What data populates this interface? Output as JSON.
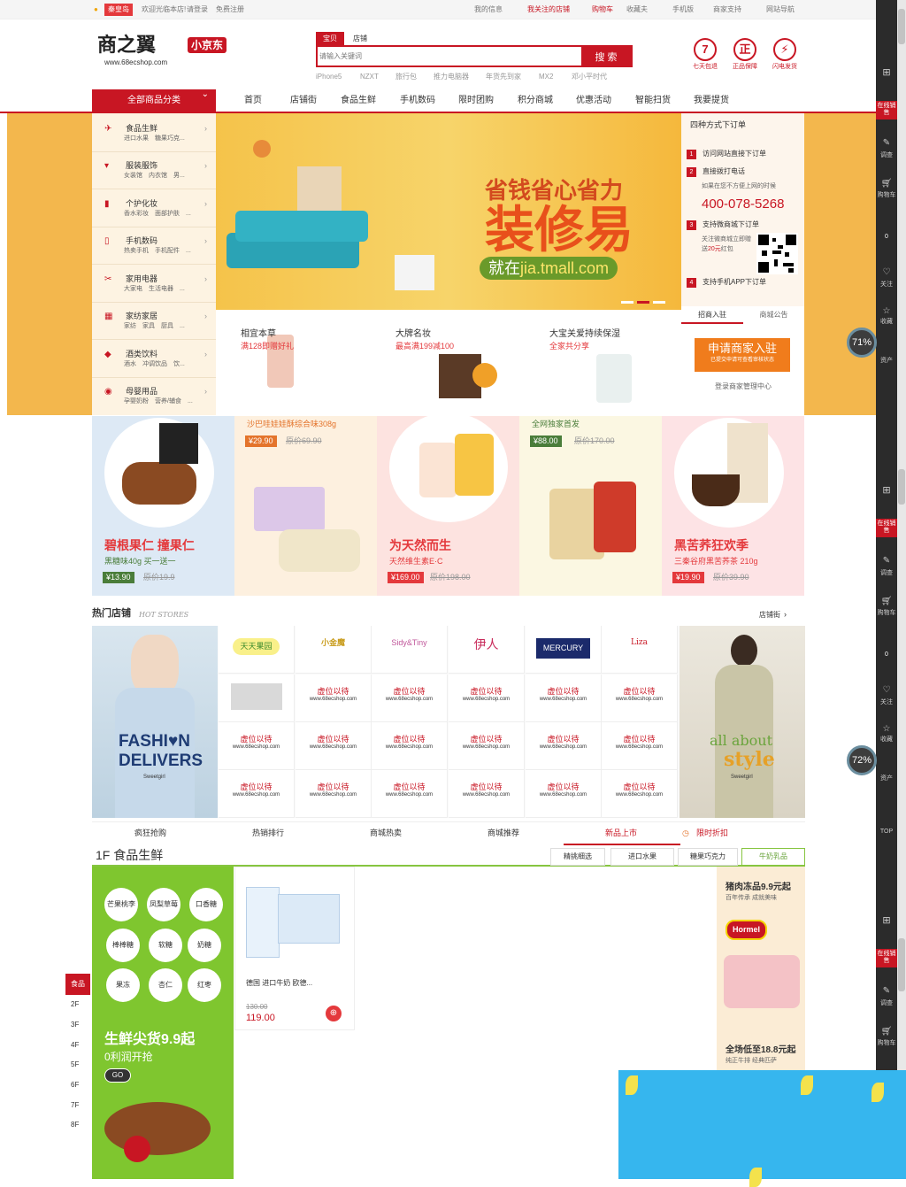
{
  "topbar": {
    "city": "秦皇岛",
    "welcome": "欢迎光临本店!",
    "login": "请登录",
    "register": "免费注册",
    "links": [
      "我的信息",
      "我关注的店铺",
      "购物车",
      "收藏夫",
      "手机版",
      "商家支持",
      "网站导航"
    ]
  },
  "header": {
    "logo_text": "商之翼",
    "logo_tag": "小京东",
    "logo_url": "www.68ecshop.com",
    "search_tabs": [
      "宝贝",
      "店铺"
    ],
    "search_placeholder": "请输入关键词",
    "search_button": "搜 索",
    "hot_words": [
      "iPhone5",
      "NZXT",
      "旅行包",
      "推力电脑器",
      "年货先到家",
      "MX2",
      "邓小平时代"
    ],
    "services": [
      {
        "icon": "7",
        "label": "七天包退"
      },
      {
        "icon": "正",
        "label": "正品保障"
      },
      {
        "icon": "⚡",
        "label": "闪电发货"
      }
    ]
  },
  "nav": {
    "all_categories": "全部商品分类",
    "items": [
      "首页",
      "店铺街",
      "食品生鲜",
      "手机数码",
      "限时团购",
      "积分商城",
      "优惠活动",
      "智能扫货",
      "我要提货"
    ]
  },
  "categories": [
    {
      "name": "食品生鲜",
      "sub": "进口水果　糖果巧克..."
    },
    {
      "name": "服装服饰",
      "sub": "女装馆　内衣馆　男..."
    },
    {
      "name": "个护化妆",
      "sub": "香水彩妆　面部护肤　..."
    },
    {
      "name": "手机数码",
      "sub": "热卖手机　手机配件　..."
    },
    {
      "name": "家用电器",
      "sub": "大家电　生活电器　..."
    },
    {
      "name": "家纺家居",
      "sub": "家纺　家具　厨具　..."
    },
    {
      "name": "酒类饮料",
      "sub": "酒水　冲调饮品　饮..."
    },
    {
      "name": "母婴用品",
      "sub": "孕婴奶粉　营养/辅食　..."
    }
  ],
  "hero": {
    "line1": "省钱省心省力",
    "line2": "装修易",
    "line3_prefix": "就在",
    "line3_url": "jia.tmall.com"
  },
  "order_box": {
    "title": "四种方式下订单",
    "steps": [
      {
        "n": "1",
        "text": "访问网站直接下订单"
      },
      {
        "n": "2",
        "text": "直接拨打电话"
      },
      {
        "n": "3",
        "text": "支持微商城下订单"
      },
      {
        "n": "4",
        "text": "支持手机APP下订单"
      }
    ],
    "phone_note": "如果在您不方便上网的时候",
    "phone": "400-078-5268",
    "wechat_note": "关注微商城立即赠送",
    "wechat_amount": "20元",
    "wechat_tail": "红包"
  },
  "promos": [
    {
      "title": "相宜本草",
      "sub": "满128即赠好礼"
    },
    {
      "title": "大牌名妆",
      "sub": "最高满199减100"
    },
    {
      "title": "大宝关爱持续保湿",
      "sub": "全家共分享"
    }
  ],
  "merchant": {
    "tabs": [
      "招商入驻",
      "商城公告"
    ],
    "button": "申请商家入驻",
    "button_sub": "已提交申请可查看审核状态",
    "link": "登录商家管理中心"
  },
  "products": [
    {
      "title": "碧根果仁 撞果仁",
      "sub": "黑糖味40g 买一送一",
      "price": "¥13.90",
      "old": "原价19.9",
      "bg": "#dde9f5"
    },
    {
      "title": "",
      "sub": "沙巴哇娃娃酥综合味308g",
      "price": "¥29.90",
      "old": "原价69.90",
      "bg": "#fdf0df"
    },
    {
      "title": "为天然而生",
      "sub": "天然维生素E·C",
      "price": "¥169.00",
      "old": "原价198.00",
      "bg": "#fde3e0"
    },
    {
      "title": "",
      "sub": "全网独家首发",
      "price": "¥88.00",
      "old": "原价170.00",
      "bg": "#fbf7e2"
    },
    {
      "title": "黑苦荞狂欢季",
      "sub": "三秦谷府黑苦荞茶 210g",
      "price": "¥19.90",
      "old": "原价39.90",
      "bg": "#fde3e5"
    }
  ],
  "hot_stores": {
    "title": "热门店铺",
    "subtitle": "HOT STORES",
    "more": "店铺街",
    "left_text1": "FASHI♥N",
    "left_text2": "DELIVERS",
    "left_sig": "Sweetgirl",
    "right_text1": "all about",
    "right_text2": "style",
    "right_sig": "Sweetgirl",
    "logos": [
      "天天果园",
      "小金魔",
      "Sidy&Tiny",
      "伊人",
      "MERCURY",
      "Liza"
    ],
    "placeholder": "虚位以待",
    "placeholder_url": "www.68ecshop.com"
  },
  "home_tabs": [
    "疯狂抢购",
    "热销排行",
    "商城热卖",
    "商城推荐",
    "新品上市",
    "限时折扣"
  ],
  "floor": {
    "title": "1F 食品生鲜",
    "tabs": [
      "精挑细选",
      "进口水果",
      "糖果巧克力",
      "牛奶乳品"
    ],
    "bubbles": [
      "芒果桃李",
      "凤梨草莓",
      "口香糖",
      "棒棒糖",
      "软糖",
      "奶糖",
      "果冻",
      "杏仁",
      "红枣"
    ],
    "banner_title": "生鲜尖货9.9起",
    "banner_sub": "0利润开抢",
    "banner_go": "GO",
    "product_name": "德国 进口牛奶 欧德...",
    "product_old": "130.00",
    "product_price": "119.00",
    "right_title": "猪肉冻品9.9元起",
    "right_sub": "百年传承 成就美味",
    "right_brand": "Hormel",
    "right_title2": "全场低至18.8元起",
    "right_sub2": "纯正牛排 经典匹萨"
  },
  "floor_nav": [
    "食品",
    "2F",
    "3F",
    "4F",
    "5F",
    "6F",
    "7F",
    "8F"
  ],
  "sidebar": {
    "online": "在线销售",
    "survey": "调查",
    "cart": "购物车",
    "cart_count": "0",
    "follow": "关注",
    "favorite": "收藏",
    "assets": "资产",
    "top": "TOP",
    "gauge1": "71%",
    "gauge2": "72%"
  },
  "colors": {
    "brand": "#c81623",
    "green": "#7fc62f",
    "banner": "#f3b74d"
  }
}
